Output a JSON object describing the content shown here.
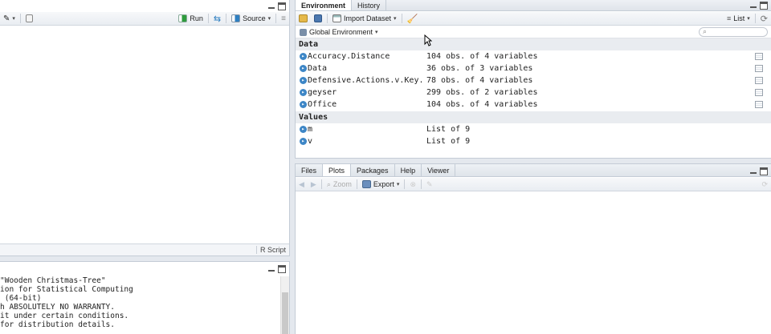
{
  "source_pane": {
    "run_label": "Run",
    "source_label": "Source",
    "script_type": "R Script"
  },
  "console": {
    "lines": [
      "\"Wooden Christmas-Tree\"",
      "ion for Statistical Computing",
      " (64-bit)",
      "",
      "h ABSOLUTELY NO WARRANTY.",
      "it under certain conditions.",
      "for distribution details."
    ]
  },
  "env_pane": {
    "tabs": [
      "Environment",
      "History"
    ],
    "import_label": "Import Dataset",
    "list_label": "List",
    "scope_label": "Global Environment",
    "search_placeholder": "",
    "data_header": "Data",
    "data_rows": [
      {
        "name": "Accuracy.Distance",
        "value": "104 obs. of 4 variables"
      },
      {
        "name": "Data",
        "value": "36 obs. of 3 variables"
      },
      {
        "name": "Defensive.Actions.v.Key...",
        "value": "78 obs. of 4 variables"
      },
      {
        "name": "geyser",
        "value": "299 obs. of 2 variables"
      },
      {
        "name": "Office",
        "value": "104 obs. of 4 variables"
      }
    ],
    "values_header": "Values",
    "value_rows": [
      {
        "name": "m",
        "value": "List of 9"
      },
      {
        "name": "v",
        "value": "List of 9"
      }
    ]
  },
  "files_pane": {
    "tabs": [
      "Files",
      "Plots",
      "Packages",
      "Help",
      "Viewer"
    ],
    "zoom_label": "Zoom",
    "export_label": "Export"
  },
  "colors": {
    "accent": "#3d86c6",
    "background": "#e4e8ee"
  }
}
